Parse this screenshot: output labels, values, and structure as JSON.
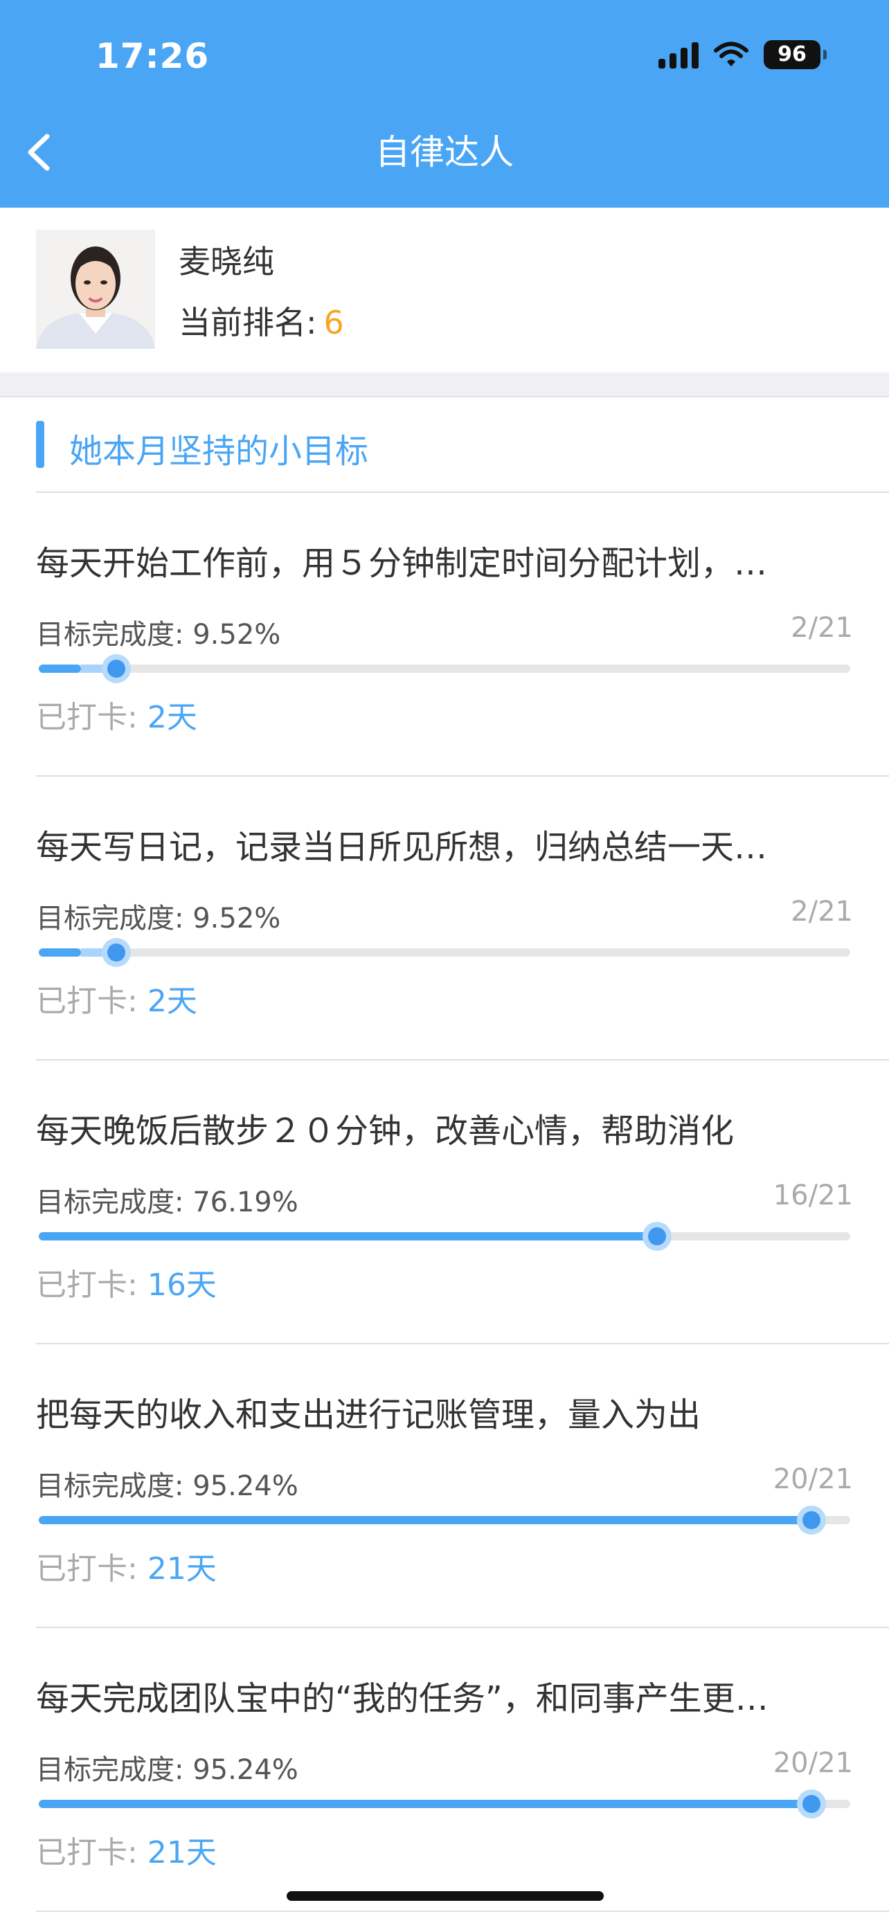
{
  "status_bar": {
    "time": "17:26",
    "battery": "96"
  },
  "nav": {
    "title": "自律达人"
  },
  "profile": {
    "name": "麦晓纯",
    "rank_label": "当前排名:",
    "rank_value": "6"
  },
  "section": {
    "title": "她本月坚持的小目标"
  },
  "goals": [
    {
      "title": "每天开始工作前，用５分钟制定时间分配计划，…",
      "progress_label": "目标完成度:",
      "progress_value": "9.52%",
      "count": "2/21",
      "fraction": 0.0952,
      "checked_label": "已打卡:",
      "checked_days": "2",
      "days_unit": "天"
    },
    {
      "title": "每天写日记，记录当日所见所想，归纳总结一天…",
      "progress_label": "目标完成度:",
      "progress_value": "9.52%",
      "count": "2/21",
      "fraction": 0.0952,
      "checked_label": "已打卡:",
      "checked_days": "2",
      "days_unit": "天"
    },
    {
      "title": "每天晚饭后散步２０分钟，改善心情，帮助消化",
      "progress_label": "目标完成度:",
      "progress_value": "76.19%",
      "count": "16/21",
      "fraction": 0.7619,
      "checked_label": "已打卡:",
      "checked_days": "16",
      "days_unit": "天"
    },
    {
      "title": "把每天的收入和支出进行记账管理，量入为出",
      "progress_label": "目标完成度:",
      "progress_value": "95.24%",
      "count": "20/21",
      "fraction": 0.9524,
      "checked_label": "已打卡:",
      "checked_days": "21",
      "days_unit": "天"
    },
    {
      "title": "每天完成团队宝中的“我的任务”，和同事产生更…",
      "progress_label": "目标完成度:",
      "progress_value": "95.24%",
      "count": "20/21",
      "fraction": 0.9524,
      "checked_label": "已打卡:",
      "checked_days": "21",
      "days_unit": "天"
    }
  ],
  "colors": {
    "accent": "#4aa6f5",
    "rank": "#f5a623",
    "muted": "#aaaaaa"
  }
}
